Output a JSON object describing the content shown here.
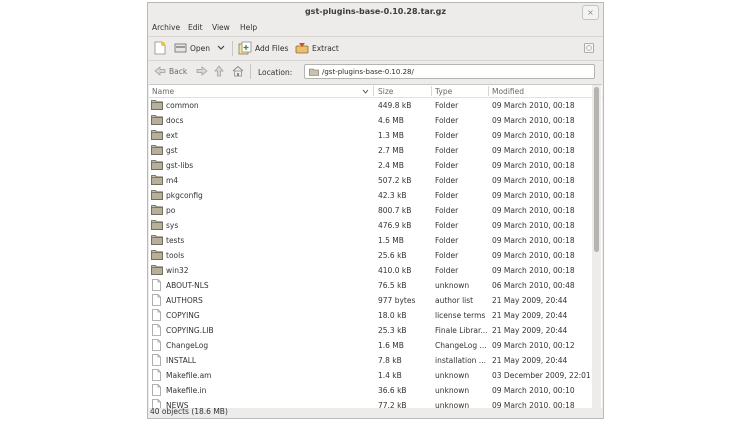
{
  "window": {
    "title": "gst-plugins-base-0.10.28.tar.gz",
    "close_glyph": "×"
  },
  "menubar": {
    "items": [
      "Archive",
      "Edit",
      "View",
      "Help"
    ]
  },
  "toolbar": {
    "open_label": "Open",
    "add_files_label": "Add Files",
    "extract_label": "Extract"
  },
  "location": {
    "back_label": "Back",
    "label": "Location:",
    "path": "/gst-plugins-base-0.10.28/"
  },
  "columns": {
    "name": "Name",
    "size": "Size",
    "type": "Type",
    "modified": "Modified"
  },
  "files": [
    {
      "name": "common",
      "size": "449.8 kB",
      "type": "Folder",
      "modified": "09 March 2010, 00:18",
      "kind": "folder"
    },
    {
      "name": "docs",
      "size": "4.6 MB",
      "type": "Folder",
      "modified": "09 March 2010, 00:18",
      "kind": "folder"
    },
    {
      "name": "ext",
      "size": "1.3 MB",
      "type": "Folder",
      "modified": "09 March 2010, 00:18",
      "kind": "folder"
    },
    {
      "name": "gst",
      "size": "2.7 MB",
      "type": "Folder",
      "modified": "09 March 2010, 00:18",
      "kind": "folder"
    },
    {
      "name": "gst-libs",
      "size": "2.4 MB",
      "type": "Folder",
      "modified": "09 March 2010, 00:18",
      "kind": "folder"
    },
    {
      "name": "m4",
      "size": "507.2 kB",
      "type": "Folder",
      "modified": "09 March 2010, 00:18",
      "kind": "folder"
    },
    {
      "name": "pkgconfig",
      "size": "42.3 kB",
      "type": "Folder",
      "modified": "09 March 2010, 00:18",
      "kind": "folder"
    },
    {
      "name": "po",
      "size": "800.7 kB",
      "type": "Folder",
      "modified": "09 March 2010, 00:18",
      "kind": "folder"
    },
    {
      "name": "sys",
      "size": "476.9 kB",
      "type": "Folder",
      "modified": "09 March 2010, 00:18",
      "kind": "folder"
    },
    {
      "name": "tests",
      "size": "1.5 MB",
      "type": "Folder",
      "modified": "09 March 2010, 00:18",
      "kind": "folder"
    },
    {
      "name": "tools",
      "size": "25.6 kB",
      "type": "Folder",
      "modified": "09 March 2010, 00:18",
      "kind": "folder"
    },
    {
      "name": "win32",
      "size": "410.0 kB",
      "type": "Folder",
      "modified": "09 March 2010, 00:18",
      "kind": "folder"
    },
    {
      "name": "ABOUT-NLS",
      "size": "76.5 kB",
      "type": "unknown",
      "modified": "06 March 2010, 00:48",
      "kind": "file"
    },
    {
      "name": "AUTHORS",
      "size": "977 bytes",
      "type": "author list",
      "modified": "21 May 2009, 20:44",
      "kind": "file"
    },
    {
      "name": "COPYING",
      "size": "18.0 kB",
      "type": "license terms",
      "modified": "21 May 2009, 20:44",
      "kind": "file"
    },
    {
      "name": "COPYING.LIB",
      "size": "25.3 kB",
      "type": "Finale Librar...",
      "modified": "21 May 2009, 20:44",
      "kind": "file"
    },
    {
      "name": "ChangeLog",
      "size": "1.6 MB",
      "type": "ChangeLog ...",
      "modified": "09 March 2010, 00:12",
      "kind": "file"
    },
    {
      "name": "INSTALL",
      "size": "7.8 kB",
      "type": "installation ...",
      "modified": "21 May 2009, 20:44",
      "kind": "file"
    },
    {
      "name": "Makefile.am",
      "size": "1.4 kB",
      "type": "unknown",
      "modified": "03 December 2009, 22:01",
      "kind": "file"
    },
    {
      "name": "Makefile.in",
      "size": "36.6 kB",
      "type": "unknown",
      "modified": "09 March 2010, 00:10",
      "kind": "file"
    },
    {
      "name": "NEWS",
      "size": "77.2 kB",
      "type": "unknown",
      "modified": "09 March 2010, 00:18",
      "kind": "file"
    }
  ],
  "status": {
    "text": "40 objects (18.6 MB)"
  }
}
